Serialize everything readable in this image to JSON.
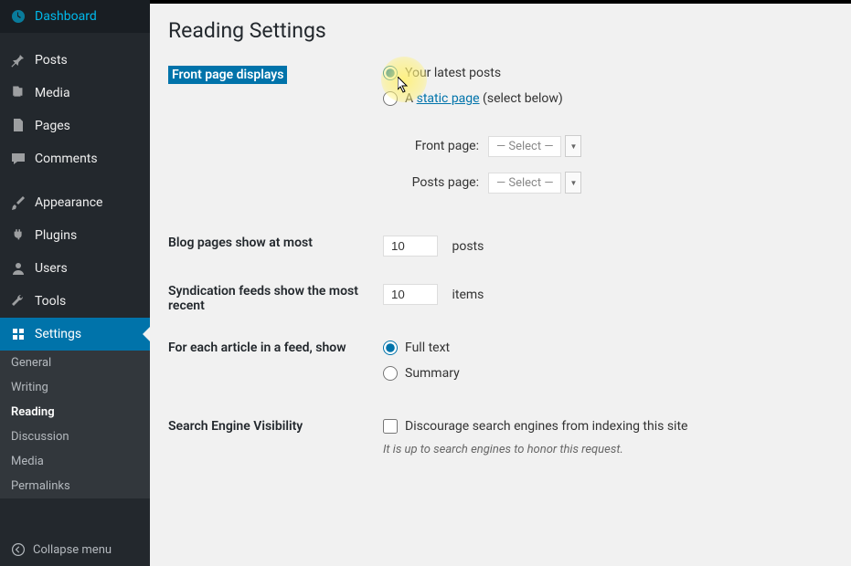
{
  "sidebar": {
    "items": [
      {
        "label": "Dashboard",
        "icon": "dashboard"
      },
      {
        "label": "Posts",
        "icon": "pin"
      },
      {
        "label": "Media",
        "icon": "media"
      },
      {
        "label": "Pages",
        "icon": "pages"
      },
      {
        "label": "Comments",
        "icon": "comments"
      },
      {
        "label": "Appearance",
        "icon": "brush"
      },
      {
        "label": "Plugins",
        "icon": "plug"
      },
      {
        "label": "Users",
        "icon": "users"
      },
      {
        "label": "Tools",
        "icon": "tools"
      },
      {
        "label": "Settings",
        "icon": "settings"
      }
    ],
    "sub": [
      {
        "label": "General"
      },
      {
        "label": "Writing"
      },
      {
        "label": "Reading"
      },
      {
        "label": "Discussion"
      },
      {
        "label": "Media"
      },
      {
        "label": "Permalinks"
      }
    ],
    "collapse": "Collapse menu"
  },
  "page": {
    "title": "Reading Settings",
    "front_page": {
      "label": "Front page displays",
      "opt1": "Your latest posts",
      "opt2_prefix": "A ",
      "opt2_link": "static page",
      "opt2_suffix": " (select below)",
      "front_label": "Front page:",
      "posts_label": "Posts page:",
      "select_placeholder": "— Select —"
    },
    "blog_pages": {
      "label": "Blog pages show at most",
      "value": "10",
      "suffix": "posts"
    },
    "syndication": {
      "label": "Syndication feeds show the most recent",
      "value": "10",
      "suffix": "items"
    },
    "article_feed": {
      "label": "For each article in a feed, show",
      "opt1": "Full text",
      "opt2": "Summary"
    },
    "search_engine": {
      "label": "Search Engine Visibility",
      "checkbox": "Discourage search engines from indexing this site",
      "note": "It is up to search engines to honor this request."
    }
  }
}
